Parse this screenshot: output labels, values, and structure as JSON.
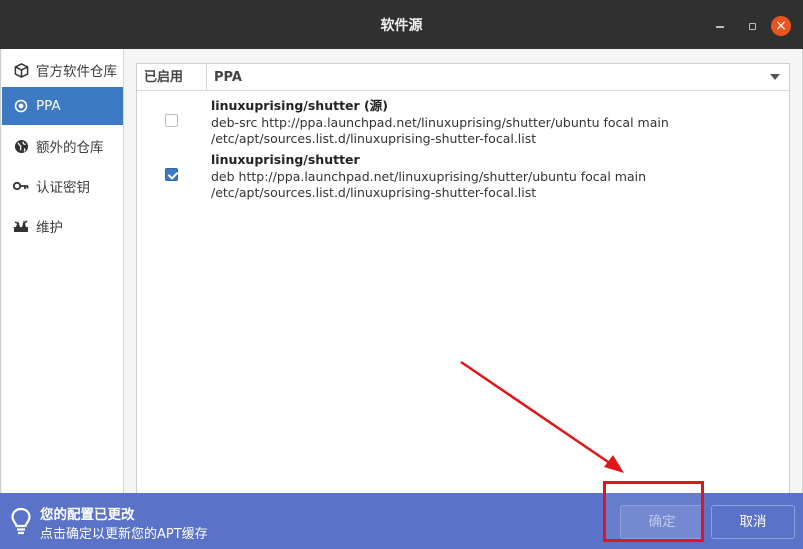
{
  "window": {
    "title": "软件源"
  },
  "sidebar": {
    "items": [
      {
        "label": "官方软件仓库",
        "icon": "package-icon",
        "selected": false
      },
      {
        "label": "PPA",
        "icon": "radio-dot-icon",
        "selected": true
      },
      {
        "label": "额外的仓库",
        "icon": "globe-icon",
        "selected": false
      },
      {
        "label": "认证密钥",
        "icon": "key-icon",
        "selected": false
      },
      {
        "label": "维护",
        "icon": "tools-icon",
        "selected": false
      }
    ]
  },
  "list": {
    "columns": [
      "已启用",
      "PPA"
    ],
    "rows": [
      {
        "enabled": false,
        "name": "linuxuprising/shutter (源)",
        "line1": "deb-src http://ppa.launchpad.net/linuxuprising/shutter/ubuntu focal main",
        "line2": "/etc/apt/sources.list.d/linuxuprising-shutter-focal.list"
      },
      {
        "enabled": true,
        "name": "linuxuprising/shutter",
        "line1": "deb http://ppa.launchpad.net/linuxuprising/shutter/ubuntu focal main",
        "line2": "/etc/apt/sources.list.d/linuxuprising-shutter-focal.list"
      }
    ]
  },
  "infobar": {
    "icon": "lightbulb-icon",
    "title": "您的配置已更改",
    "subtitle": "点击确定以更新您的APT缓存",
    "ok_label": "确定",
    "cancel_label": "取消"
  },
  "colors": {
    "titlebar": "#303030",
    "selection": "#3d7ac4",
    "infobar": "#5b72c9",
    "close": "#e95420",
    "annotation": "#e0161b"
  }
}
